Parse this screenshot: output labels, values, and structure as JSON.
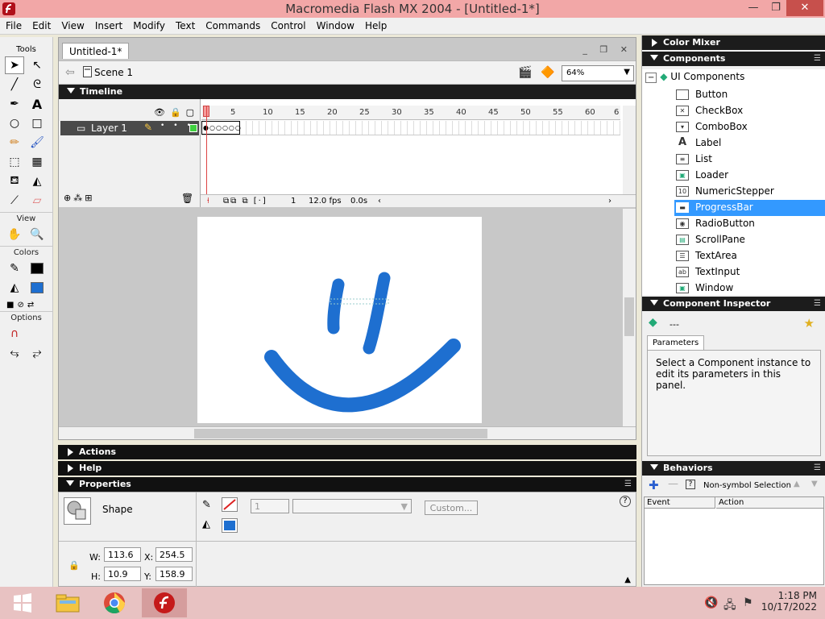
{
  "window": {
    "title": "Macromedia Flash MX 2004 - [Untitled-1*]",
    "minimize": "—",
    "restore": "❐",
    "close": "✕"
  },
  "menu": [
    "File",
    "Edit",
    "View",
    "Insert",
    "Modify",
    "Text",
    "Commands",
    "Control",
    "Window",
    "Help"
  ],
  "tools": {
    "title": "Tools",
    "view_label": "View",
    "colors_label": "Colors",
    "options_label": "Options"
  },
  "document": {
    "tab": "Untitled-1*",
    "scene": "Scene 1",
    "zoom": "64%"
  },
  "timeline": {
    "title": "Timeline",
    "layer_name": "Layer 1",
    "ruler": [
      "1",
      "5",
      "10",
      "15",
      "20",
      "25",
      "30",
      "35",
      "40",
      "45",
      "50",
      "55",
      "60",
      "6"
    ],
    "current_frame": "1",
    "fps": "12.0 fps",
    "time": "0.0s"
  },
  "stage": {
    "stroke_color": "#1e6fd0"
  },
  "panels": {
    "actions": "Actions",
    "help": "Help",
    "properties": "Properties"
  },
  "properties": {
    "type": "Shape",
    "stroke_height": "1",
    "custom_button": "Custom...",
    "w_label": "W:",
    "w_value": "113.6",
    "h_label": "H:",
    "h_value": "10.9",
    "x_label": "X:",
    "x_value": "254.5",
    "y_label": "Y:",
    "y_value": "158.9",
    "help_icon": "?"
  },
  "right": {
    "color_mixer": "Color Mixer",
    "components": "Components",
    "ui_components": "UI Components",
    "items": [
      "Button",
      "CheckBox",
      "ComboBox",
      "Label",
      "List",
      "Loader",
      "NumericStepper",
      "ProgressBar",
      "RadioButton",
      "ScrollPane",
      "TextArea",
      "TextInput",
      "Window"
    ],
    "selected_item": "ProgressBar",
    "inspector": "Component Inspector",
    "inspector_value": "---",
    "parameters_tab": "Parameters",
    "inspector_msg": "Select a Component instance to edit its parameters in this panel.",
    "behaviors": "Behaviors",
    "behaviors_sel": "Non-symbol Selection",
    "col_event": "Event",
    "col_action": "Action"
  },
  "taskbar": {
    "time": "1:18 PM",
    "date": "10/17/2022"
  }
}
